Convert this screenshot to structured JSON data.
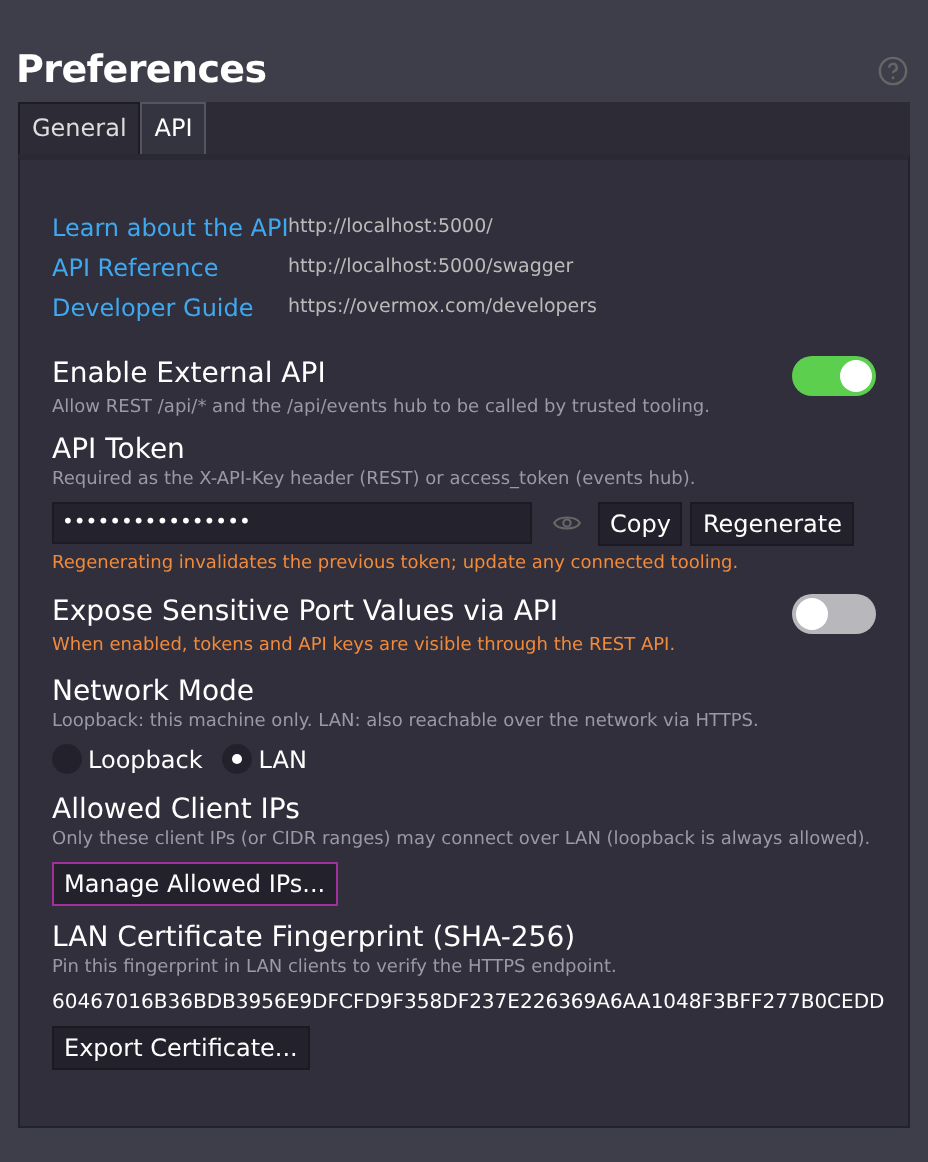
{
  "title": "Preferences",
  "tabs": [
    {
      "label": "General",
      "selected": false
    },
    {
      "label": "API",
      "selected": true
    }
  ],
  "links": [
    {
      "label": "Learn about the API",
      "url": "http://localhost:5000/"
    },
    {
      "label": "API Reference",
      "url": "http://localhost:5000/swagger"
    },
    {
      "label": "Developer Guide",
      "url": "https://overmox.com/developers"
    }
  ],
  "enable_api": {
    "label": "Enable External API",
    "description": "Allow REST /api/* and the /api/events hub to be called by trusted tooling.",
    "on": true
  },
  "api_token": {
    "label": "API Token",
    "description": "Required as the X-API-Key header (REST) or access_token (events hub).",
    "value": "••••••••••••••••",
    "buttons": [
      "Copy",
      "Regenerate"
    ],
    "warning": "Regenerating invalidates the previous token; update any connected tooling."
  },
  "expose_sensitive": {
    "label": "Expose Sensitive Port Values via API",
    "warning": "When enabled, tokens and API keys are visible through the REST API.",
    "on": false
  },
  "network_mode": {
    "label": "Network Mode",
    "description": "Loopback: this machine only. LAN: also reachable over the network via HTTPS.",
    "options": [
      {
        "label": "Loopback",
        "selected": false
      },
      {
        "label": "LAN",
        "selected": true
      }
    ]
  },
  "allowed_ips": {
    "label": "Allowed Client IPs",
    "description": "Only these client IPs (or CIDR ranges) may connect over LAN (loopback is always allowed).",
    "button": {
      "label": "Manage Allowed IPs...",
      "focused": true
    }
  },
  "fingerprint": {
    "label": "LAN Certificate Fingerprint (SHA-256)",
    "description": "Pin this fingerprint in LAN clients to verify the HTTPS endpoint.",
    "value": "60467016B36BDB3956E9DFCFD9F358DF237E226369A6AA1048F3BFF277B0CEDD",
    "button": {
      "label": "Export Certificate...",
      "focused": false
    }
  }
}
